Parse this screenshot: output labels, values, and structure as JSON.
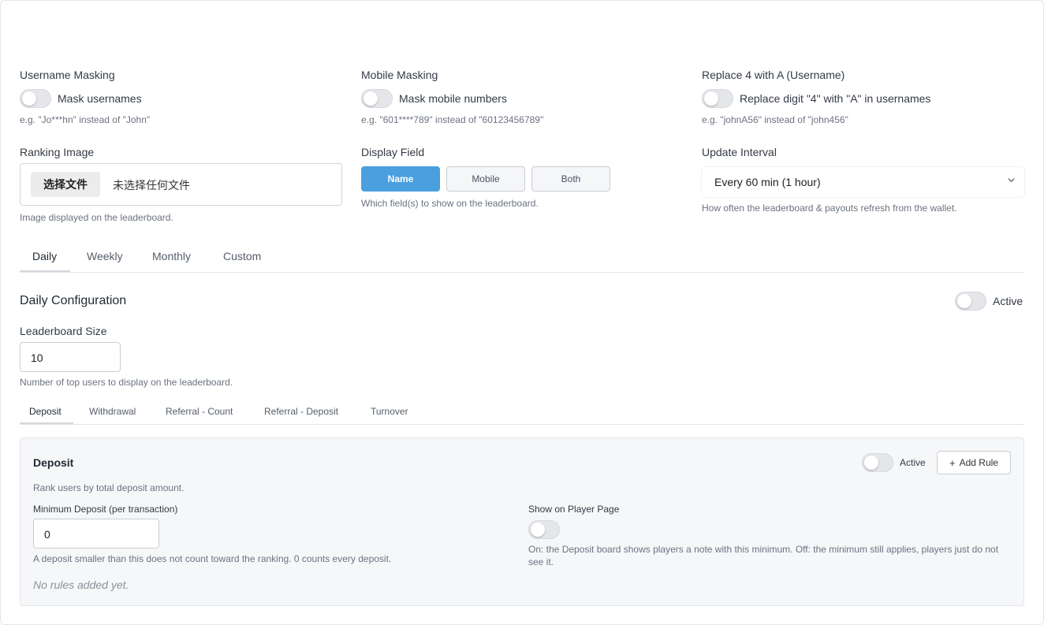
{
  "masking": {
    "username": {
      "title": "Username Masking",
      "toggle_label": "Mask usernames",
      "help": "e.g. \"Jo***hn\" instead of \"John\"",
      "enabled": false
    },
    "mobile": {
      "title": "Mobile Masking",
      "toggle_label": "Mask mobile numbers",
      "help": "e.g. \"601****789\" instead of \"60123456789\"",
      "enabled": false
    },
    "replace4": {
      "title": "Replace 4 with A (Username)",
      "toggle_label": "Replace digit \"4\" with \"A\" in usernames",
      "help": "e.g. \"johnA56\" instead of \"john456\"",
      "enabled": false
    }
  },
  "ranking_image": {
    "title": "Ranking Image",
    "button_label": "选择文件",
    "status": "未选择任何文件",
    "help": "Image displayed on the leaderboard."
  },
  "display_field": {
    "title": "Display Field",
    "options": [
      "Name",
      "Mobile",
      "Both"
    ],
    "selected": "Name",
    "help": "Which field(s) to show on the leaderboard."
  },
  "update_interval": {
    "title": "Update Interval",
    "value": "Every 60 min (1 hour)",
    "help": "How often the leaderboard & payouts refresh from the wallet."
  },
  "period_tabs": [
    "Daily",
    "Weekly",
    "Monthly",
    "Custom"
  ],
  "active_period_tab": "Daily",
  "config": {
    "title": "Daily Configuration",
    "active_label": "Active",
    "active": false,
    "size_label": "Leaderboard Size",
    "size_value": "10",
    "size_help": "Number of top users to display on the leaderboard."
  },
  "metric_tabs": [
    "Deposit",
    "Withdrawal",
    "Referral - Count",
    "Referral - Deposit",
    "Turnover"
  ],
  "active_metric_tab": "Deposit",
  "deposit_panel": {
    "title": "Deposit",
    "active_label": "Active",
    "active": false,
    "add_rule_label": "Add Rule",
    "description": "Rank users by total deposit amount.",
    "min_label": "Minimum Deposit (per transaction)",
    "min_value": "0",
    "min_help": "A deposit smaller than this does not count toward the ranking. 0 counts every deposit.",
    "show_label": "Show on Player Page",
    "show_enabled": false,
    "show_help": "On: the Deposit board shows players a note with this minimum. Off: the minimum still applies, players just do not see it.",
    "empty_rules": "No rules added yet."
  },
  "colors": {
    "accent": "#4a9fde",
    "toggle_off": "#e4e6ea",
    "panel_bg": "#f6f7f9"
  }
}
